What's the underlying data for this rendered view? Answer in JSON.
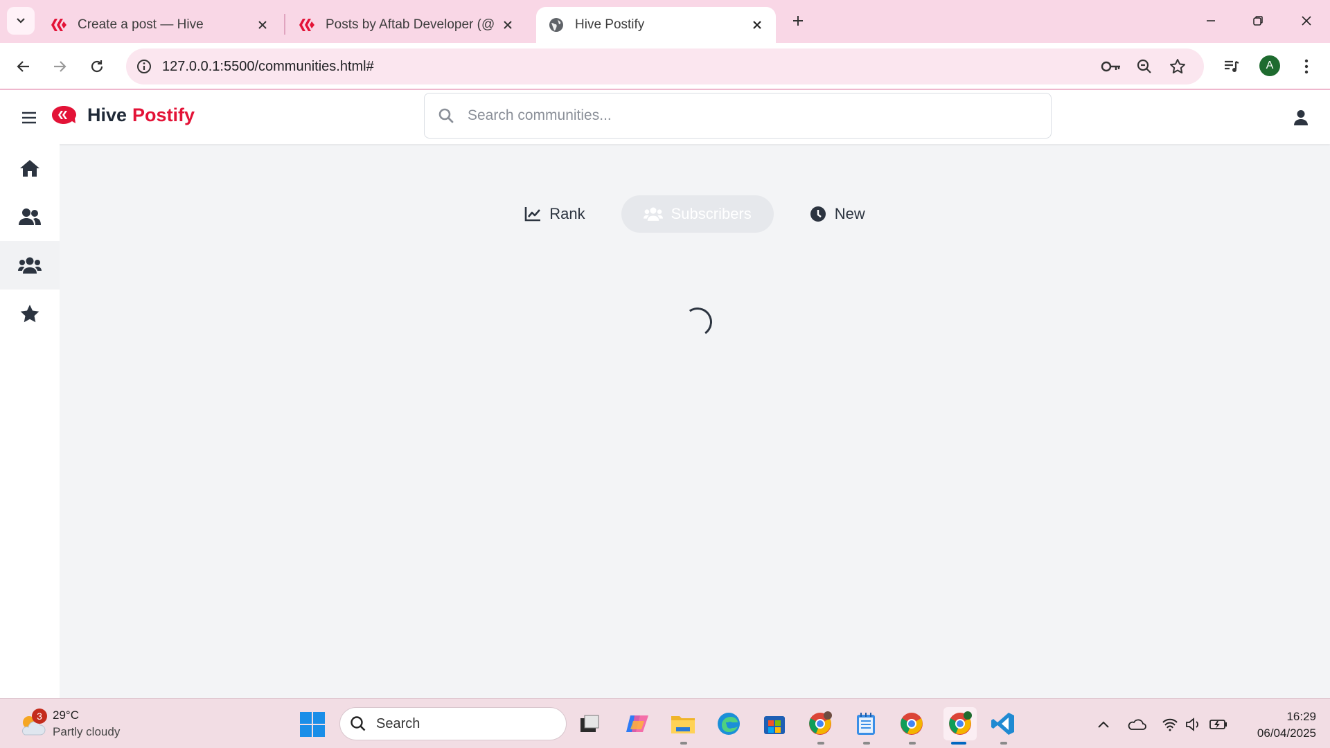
{
  "browser": {
    "tabs": [
      {
        "title": "Create a post — Hive",
        "favicon": "hive-logo-icon",
        "active": false
      },
      {
        "title": "Posts by Aftab Developer (@aft",
        "favicon": "hive-logo-icon",
        "active": false
      },
      {
        "title": "Hive Postify",
        "favicon": "globe-icon",
        "active": true
      }
    ],
    "url": "127.0.0.1:5500/communities.html#",
    "profile_initial": "A"
  },
  "header": {
    "brand_part1": "Hive",
    "brand_part2": "Postify",
    "search_placeholder": "Search communities...",
    "brand_color": "#e31337"
  },
  "sidebar": {
    "items": [
      {
        "name": "home",
        "icon": "home-icon",
        "active": false
      },
      {
        "name": "users",
        "icon": "users-icon",
        "active": false
      },
      {
        "name": "communities",
        "icon": "communities-icon",
        "active": true
      },
      {
        "name": "favorites",
        "icon": "star-icon",
        "active": false
      }
    ]
  },
  "sort_tabs": [
    {
      "label": "Rank",
      "icon": "chart-line-icon",
      "active": false
    },
    {
      "label": "Subscribers",
      "icon": "users-icon",
      "active": true
    },
    {
      "label": "New",
      "icon": "clock-icon",
      "active": false
    }
  ],
  "taskbar": {
    "weather": {
      "temp": "29°C",
      "condition": "Partly cloudy",
      "badge": "3"
    },
    "search_label": "Search",
    "time": "16:29",
    "date": "06/04/2025"
  }
}
